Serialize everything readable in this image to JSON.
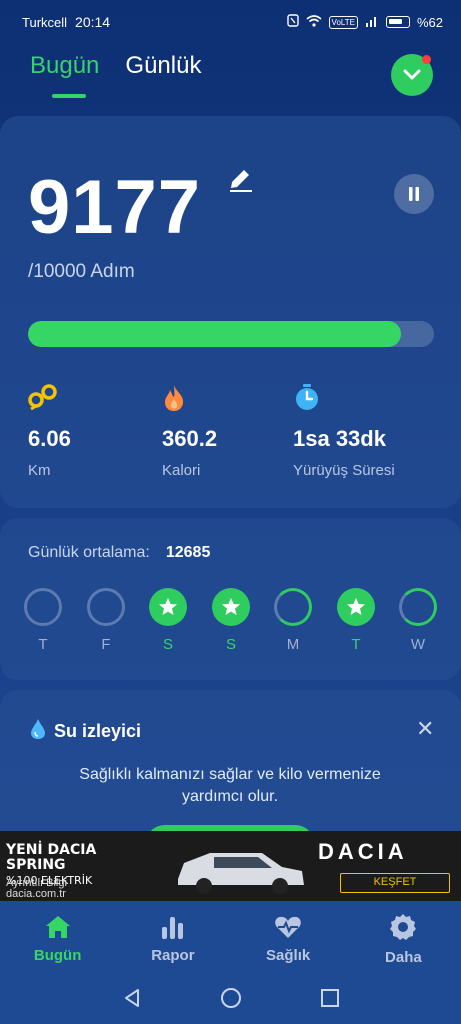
{
  "status_bar": {
    "carrier": "Turkcell",
    "time": "20:14",
    "battery": "%62",
    "volte": "VoLTE"
  },
  "tabs": [
    {
      "label": "Bugün",
      "active": true
    },
    {
      "label": "Günlük",
      "active": false
    }
  ],
  "steps": {
    "value": "9177",
    "goal_text": "/10000 Adım",
    "progress": 0.9177
  },
  "stats": [
    {
      "icon": "distance-icon",
      "value": "6.06",
      "label": "Km"
    },
    {
      "icon": "fire-icon",
      "value": "360.2",
      "label": "Kalori"
    },
    {
      "icon": "stopwatch-icon",
      "value": "1sa 33dk",
      "label": "Yürüyüş Süresi"
    }
  ],
  "daily_average": {
    "label": "Günlük ortalama:",
    "value": "12685",
    "days": [
      {
        "letter": "T",
        "state": "empty"
      },
      {
        "letter": "F",
        "state": "empty"
      },
      {
        "letter": "S",
        "state": "done"
      },
      {
        "letter": "S",
        "state": "done"
      },
      {
        "letter": "M",
        "state": "partial"
      },
      {
        "letter": "T",
        "state": "done"
      },
      {
        "letter": "W",
        "state": "partial"
      }
    ]
  },
  "water": {
    "title": "Su izleyici",
    "description": "Sağlıklı kalmanızı sağlar ve kilo vermenize yardımcı olur."
  },
  "ad": {
    "line1": "YENİ DACIA",
    "line2": "SPRING",
    "line3": "%100 ELEKTRİK",
    "line4": "Ayrıntılı Bilgi",
    "url": "dacia.com.tr",
    "brand": "DACIA",
    "cta": "KEŞFET"
  },
  "bottom_nav": [
    {
      "label": "Bugün",
      "icon": "home-icon",
      "active": true
    },
    {
      "label": "Rapor",
      "icon": "bar-chart-icon",
      "active": false
    },
    {
      "label": "Sağlık",
      "icon": "heart-pulse-icon",
      "active": false
    },
    {
      "label": "Daha",
      "icon": "gear-icon",
      "active": false
    }
  ],
  "colors": {
    "accent": "#35d663",
    "background": "#173e86",
    "card": "#28509a"
  }
}
